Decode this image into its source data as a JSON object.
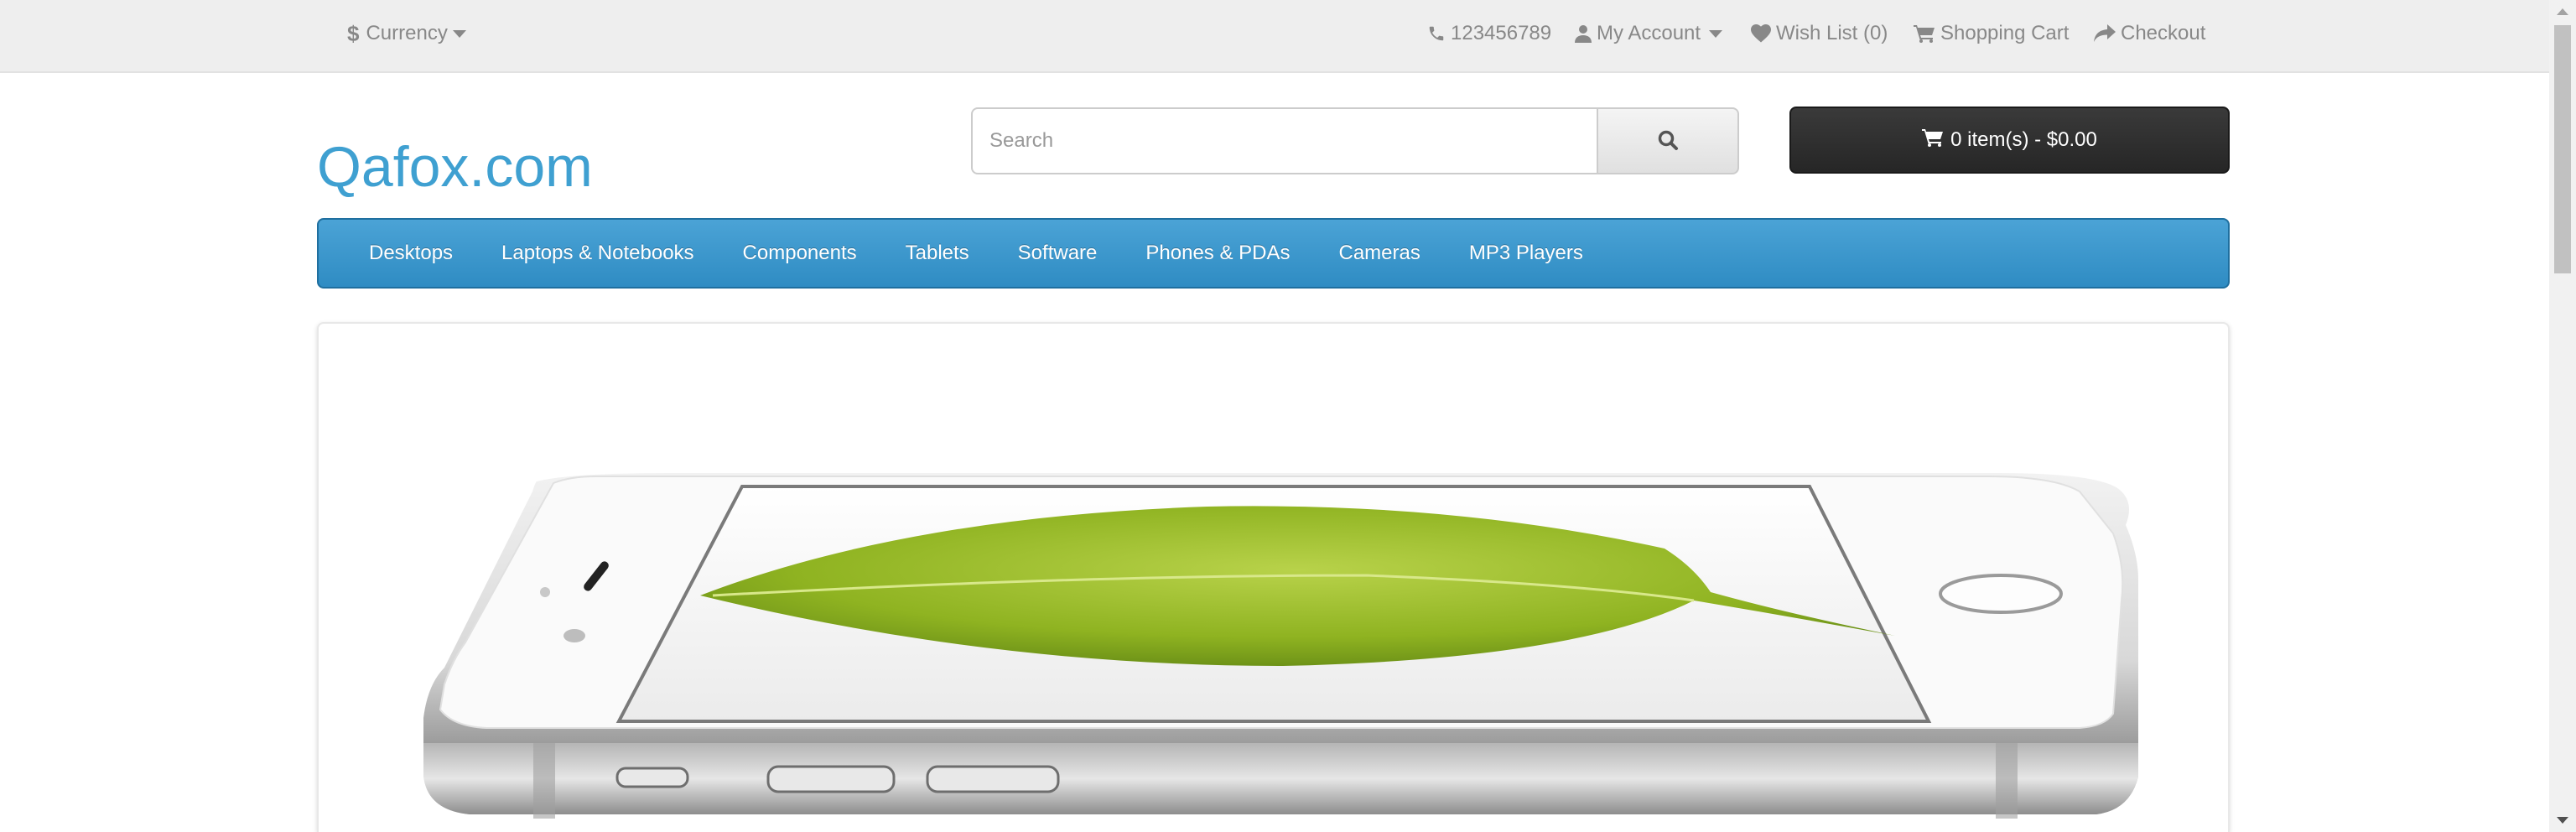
{
  "topbar": {
    "currency": {
      "symbol": "$",
      "label": "Currency"
    },
    "phone": "123456789",
    "my_account": "My Account",
    "wish_list": "Wish List (0)",
    "shopping_cart": "Shopping Cart",
    "checkout": "Checkout"
  },
  "header": {
    "logo": "Qafox.com",
    "search": {
      "placeholder": "Search",
      "value": ""
    },
    "cart_button": "0 item(s) - $0.00"
  },
  "nav": {
    "items": [
      {
        "label": "Desktops"
      },
      {
        "label": "Laptops & Notebooks"
      },
      {
        "label": "Components"
      },
      {
        "label": "Tablets"
      },
      {
        "label": "Software"
      },
      {
        "label": "Phones & PDAs"
      },
      {
        "label": "Cameras"
      },
      {
        "label": "MP3 Players"
      }
    ]
  },
  "colors": {
    "accent": "#3fa0d1",
    "nav_bg": "#3b95cc",
    "cart_button_bg": "#303030",
    "topbar_bg": "#eeeeee"
  },
  "icons": {
    "phone": "phone-icon",
    "account": "user-icon",
    "wishlist": "heart-icon",
    "cart": "shopping-cart-icon",
    "checkout": "share-icon",
    "search": "search-icon"
  }
}
